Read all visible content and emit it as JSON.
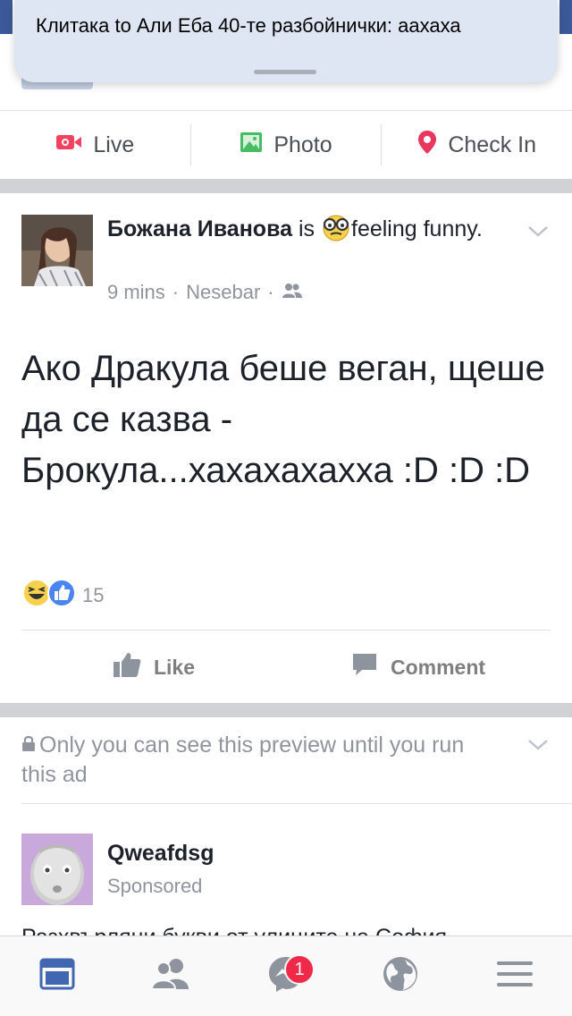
{
  "notification": {
    "text": "Клитака to Али Еба 40-те разбойнички: аахаха"
  },
  "composer": {
    "live_label": "Live",
    "photo_label": "Photo",
    "checkin_label": "Check In"
  },
  "post": {
    "author": "Божана Иванова",
    "is_word": "is",
    "feeling": "feeling funny.",
    "time": "9 mins",
    "location": "Nesebar",
    "separator": "·",
    "body": "Ако Дракула беше веган, щеше да се казва - Брокула...хахахахахха :D :D :D",
    "reaction_count": "15",
    "like_label": "Like",
    "comment_label": "Comment"
  },
  "ad": {
    "notice": "Only you can see this preview until you run this ad",
    "page_name": "Qweafdsg",
    "sponsored": "Sponsored",
    "preview_text": "Разхвърляни букви от улиците на София"
  },
  "tabbar": {
    "messenger_badge": "1"
  },
  "colors": {
    "brand_blue": "#3b5998",
    "tab_active": "#4267b2",
    "live_red": "#f3425f",
    "photo_green": "#45bd62",
    "checkin_pink": "#e9365e",
    "badge_red": "#f02849"
  }
}
